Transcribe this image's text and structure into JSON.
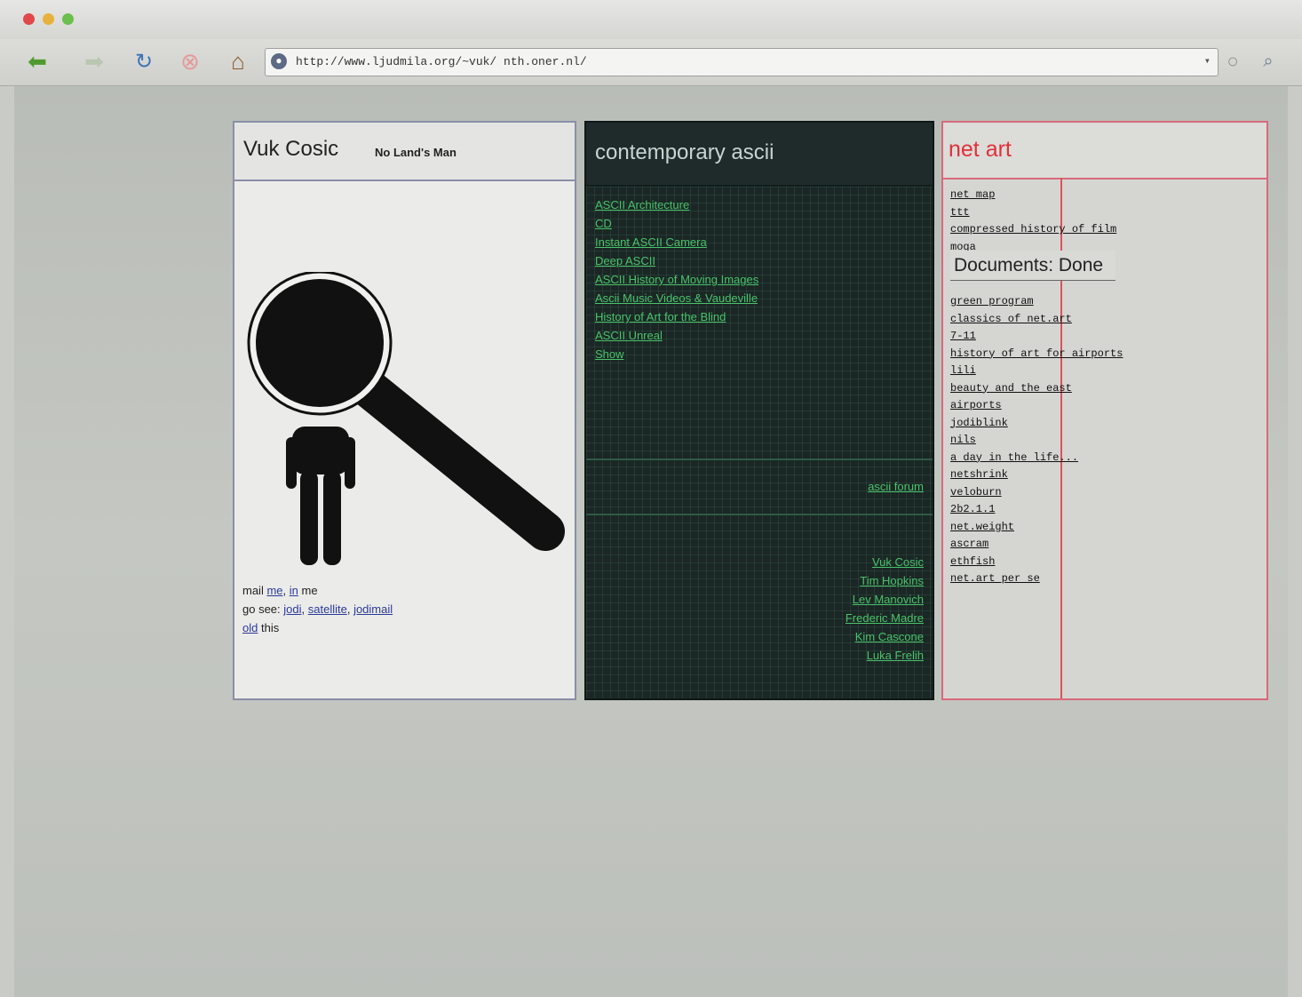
{
  "browser": {
    "url": "http://www.ljudmila.org/~vuk/ nth.oner.nl/",
    "colors": {
      "chrome": "#d5d6d2",
      "close": "#e0484a",
      "minimize": "#e7b13b",
      "zoom": "#6bbf4d"
    }
  },
  "left_panel": {
    "title": "Vuk Cosic",
    "tagline": "No Land's Man",
    "mail_prefix": "mail",
    "mail_link_me": "me",
    "mail_sep": ", ",
    "mail_link_in": "in",
    "mail_suffix": " me",
    "go_prefix": "go see: ",
    "go_links": [
      "jodi",
      "satellite",
      "jodimail"
    ],
    "last_link": "old",
    "last_suffix": " this"
  },
  "middle_panel": {
    "title": "contemporary ascii",
    "links": [
      "ASCII Architecture",
      "CD",
      "Instant ASCII Camera",
      "Deep ASCII",
      "ASCII History of Moving Images",
      "Ascii Music Videos & Vaudeville",
      "History of Art for the Blind",
      "ASCII Unreal",
      "Show"
    ],
    "mid_link": "ascii forum",
    "people": [
      "Vuk Cosic",
      "Tim Hopkins",
      "Lev Manovich",
      "Frederic Madre",
      "Kim Cascone",
      "Luka Frelih"
    ]
  },
  "right_panel": {
    "title": "net art",
    "links_top": [
      "net map",
      "ttt",
      "compressed history of film",
      "moga"
    ],
    "status_text": "Documents: Done",
    "links_bottom": [
      "green program",
      "classics of net.art",
      "7-11",
      "history of art for airports",
      "lili",
      "beauty and the east",
      "airports",
      "jodiblink",
      "nils",
      "a day in the life...",
      "netshrink",
      "veloburn",
      "2b2.1.1",
      "net.weight",
      "ascram",
      "ethfish",
      "net.art per se"
    ]
  }
}
